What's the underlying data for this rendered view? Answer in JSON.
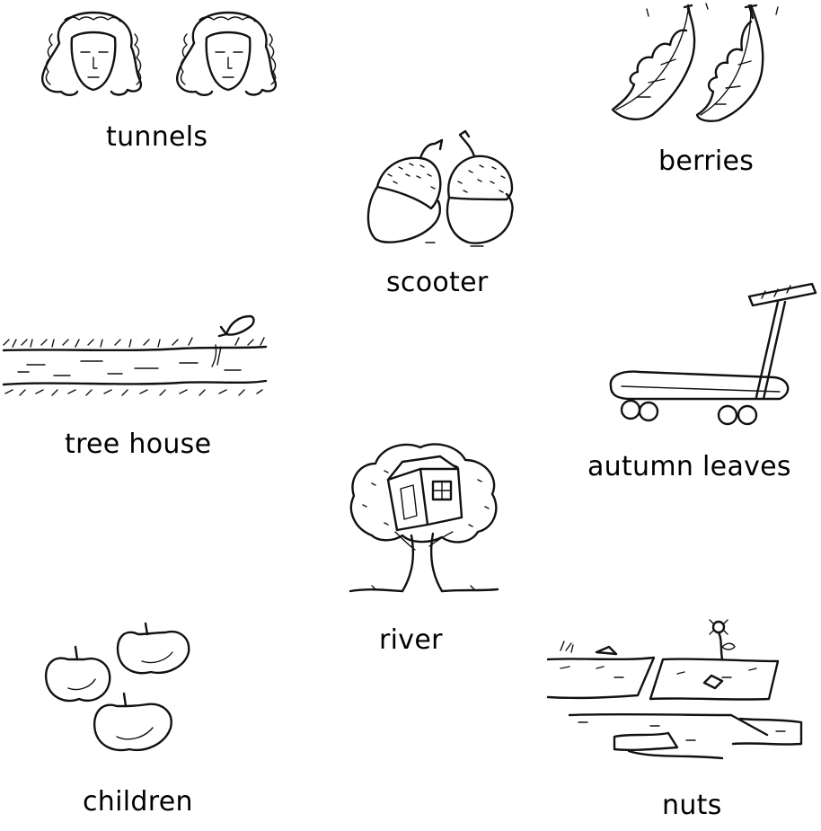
{
  "labels": {
    "tunnels": "tunnels",
    "berries": "berries",
    "scooter": "scooter",
    "tree_house": "tree house",
    "autumn_leaves": "autumn leaves",
    "river": "river",
    "children": "children",
    "nuts": "nuts"
  },
  "icons": {
    "children_faces": "children-faces-icon",
    "autumn_leaves": "autumn-leaves-icon",
    "nuts": "acorns-icon",
    "river": "river-icon",
    "scooter": "scooter-icon",
    "tree_house": "tree-house-icon",
    "berries": "apples-icon",
    "tunnels": "tunnels-icon"
  },
  "colors": {
    "ink": "#111111",
    "background": "#ffffff"
  }
}
